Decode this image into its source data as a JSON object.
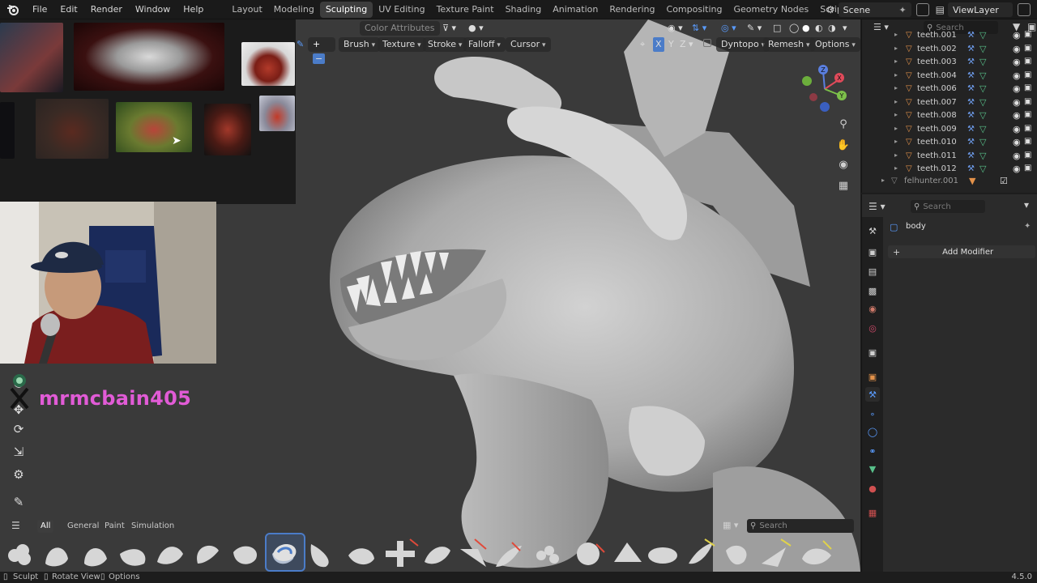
{
  "menu": [
    "File",
    "Edit",
    "Render",
    "Window",
    "Help"
  ],
  "workspaces": [
    {
      "label": "Layout",
      "active": false
    },
    {
      "label": "Modeling",
      "active": false
    },
    {
      "label": "Sculpting",
      "active": true
    },
    {
      "label": "UV Editing",
      "active": false
    },
    {
      "label": "Texture Paint",
      "active": false
    },
    {
      "label": "Shading",
      "active": false
    },
    {
      "label": "Animation",
      "active": false
    },
    {
      "label": "Rendering",
      "active": false
    },
    {
      "label": "Compositing",
      "active": false
    },
    {
      "label": "Geometry Nodes",
      "active": false
    },
    {
      "label": "Scripting",
      "active": false
    }
  ],
  "scene": "Scene",
  "view_layer": "ViewLayer",
  "viewport_header": {
    "color_attributes": "Color Attributes",
    "brush": "Brush",
    "texture": "Texture",
    "stroke": "Stroke",
    "falloff": "Falloff",
    "cursor": "Cursor",
    "x": "X",
    "y": "Y",
    "z": "Z",
    "dyntopo": "Dyntopo",
    "remesh": "Remesh",
    "options": "Options"
  },
  "streamer_name": "mrmcbain405",
  "shelf": {
    "tabs": [
      {
        "label": "All",
        "active": true
      },
      {
        "label": "General",
        "active": false
      },
      {
        "label": "Paint",
        "active": false
      },
      {
        "label": "Simulation",
        "active": false
      }
    ],
    "search_placeholder": "Search"
  },
  "outliner": {
    "search_placeholder": "Search",
    "items": [
      {
        "name": "teeth.001"
      },
      {
        "name": "teeth.002"
      },
      {
        "name": "teeth.003"
      },
      {
        "name": "teeth.004"
      },
      {
        "name": "teeth.006"
      },
      {
        "name": "teeth.007"
      },
      {
        "name": "teeth.008"
      },
      {
        "name": "teeth.009"
      },
      {
        "name": "teeth.010"
      },
      {
        "name": "teeth.011"
      },
      {
        "name": "teeth.012"
      },
      {
        "name": "felhunter.001"
      }
    ]
  },
  "properties": {
    "search_placeholder": "Search",
    "object_name": "body",
    "add_modifier": "Add Modifier"
  },
  "status": {
    "sculpt": "Sculpt",
    "rotate_view": "Rotate View",
    "options": "Options",
    "version": "4.5.0"
  },
  "colors": {
    "accent": "#4b7cc8",
    "streamer": "#e15bd6",
    "object_orange": "#e3924a",
    "data_green": "#58c08a"
  }
}
